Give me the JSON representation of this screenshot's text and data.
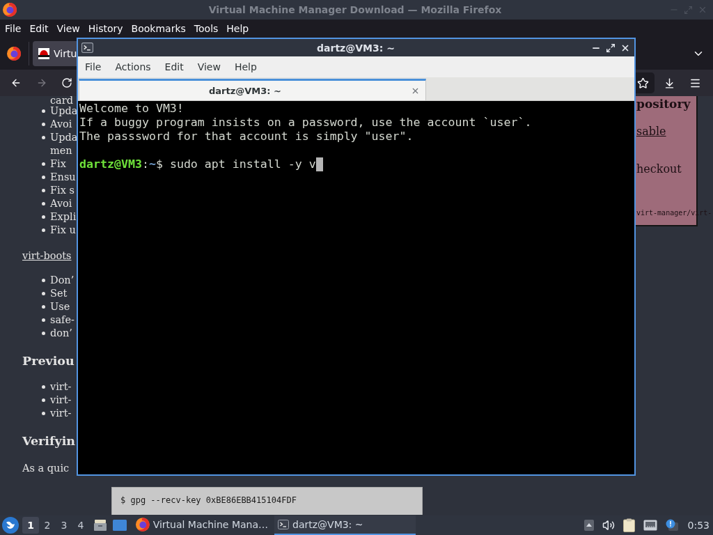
{
  "firefox": {
    "title": "Virtual Machine Manager Download — Mozilla Firefox",
    "menu": [
      "File",
      "Edit",
      "View",
      "History",
      "Bookmarks",
      "Tools",
      "Help"
    ],
    "tabs": [
      {
        "label": "Virtu",
        "selected": true
      }
    ],
    "navigation": {
      "back": {
        "disabled": false
      },
      "forward": {
        "disabled": true
      }
    },
    "page": {
      "blocks": [
        {
          "kind": "list",
          "items": [
            {
              "bullet": false,
              "lines": [
                "card"
              ]
            },
            {
              "bullet": true,
              "lines": [
                "Upda"
              ]
            },
            {
              "bullet": true,
              "lines": [
                "Avoi"
              ]
            },
            {
              "bullet": true,
              "lines": [
                "Upda",
                "men"
              ]
            },
            {
              "bullet": true,
              "lines": [
                "Fix"
              ]
            },
            {
              "bullet": true,
              "lines": [
                "Ensu"
              ]
            },
            {
              "bullet": true,
              "lines": [
                "Fix s"
              ]
            },
            {
              "bullet": true,
              "lines": [
                "Avoi"
              ]
            },
            {
              "bullet": true,
              "lines": [
                "Expli"
              ]
            },
            {
              "bullet": true,
              "lines": [
                "Fix u"
              ]
            }
          ]
        },
        {
          "kind": "link",
          "text": "virt-boots"
        },
        {
          "kind": "list",
          "items": [
            {
              "bullet": true,
              "lines": [
                "Don’"
              ]
            },
            {
              "bullet": true,
              "lines": [
                "Set"
              ]
            },
            {
              "bullet": true,
              "lines": [
                "Use"
              ]
            },
            {
              "bullet": true,
              "lines": [
                "safe-"
              ]
            },
            {
              "bullet": true,
              "lines": [
                "don’"
              ]
            }
          ]
        },
        {
          "kind": "heading",
          "text": "Previou"
        },
        {
          "kind": "list",
          "items": [
            {
              "bullet": true,
              "lines": [
                "virt-"
              ]
            },
            {
              "bullet": true,
              "lines": [
                "virt-"
              ]
            },
            {
              "bullet": true,
              "lines": [
                "virt-"
              ]
            }
          ]
        },
        {
          "kind": "heading",
          "text": "Verifyin"
        },
        {
          "kind": "paragraph",
          "text": "As a quic"
        }
      ],
      "aside": {
        "heading": "pository",
        "link": "sable",
        "text": "heckout",
        "code": "virt-manager/virt-"
      },
      "code_block": [
        "$ gpg --recv-key 0xBE86EBB415104FDF"
      ]
    }
  },
  "terminal": {
    "title": "dartz@VM3: ~",
    "menu": [
      "File",
      "Actions",
      "Edit",
      "View",
      "Help"
    ],
    "tabs": [
      {
        "label": "dartz@VM3: ~",
        "selected": true
      }
    ],
    "lines": [
      {
        "kind": "output",
        "text": "Welcome to VM3!"
      },
      {
        "kind": "output",
        "text": "If a buggy program insists on a password, use the account `user`."
      },
      {
        "kind": "output",
        "text": "The passsword for that account is simply \"user\"."
      },
      {
        "kind": "blank"
      },
      {
        "kind": "prompt",
        "segments": [
          {
            "kind": "user",
            "text": "dartz@VM3"
          },
          {
            "kind": "plain",
            "text": ":"
          },
          {
            "kind": "path",
            "text": "~"
          },
          {
            "kind": "plain",
            "text": "$ sudo apt install -y v"
          }
        ],
        "cursor": true
      }
    ]
  },
  "taskbar": {
    "workspaces": [
      {
        "label": "1",
        "selected": true
      },
      {
        "label": "2",
        "selected": false
      },
      {
        "label": "3",
        "selected": false
      },
      {
        "label": "4",
        "selected": false
      }
    ],
    "tasks": [
      {
        "kind": "browser",
        "label": "Virtual Machine Mana…",
        "selected": false
      },
      {
        "kind": "terminal",
        "label": "dartz@VM3: ~",
        "selected": true
      }
    ],
    "clock": "0:53"
  }
}
